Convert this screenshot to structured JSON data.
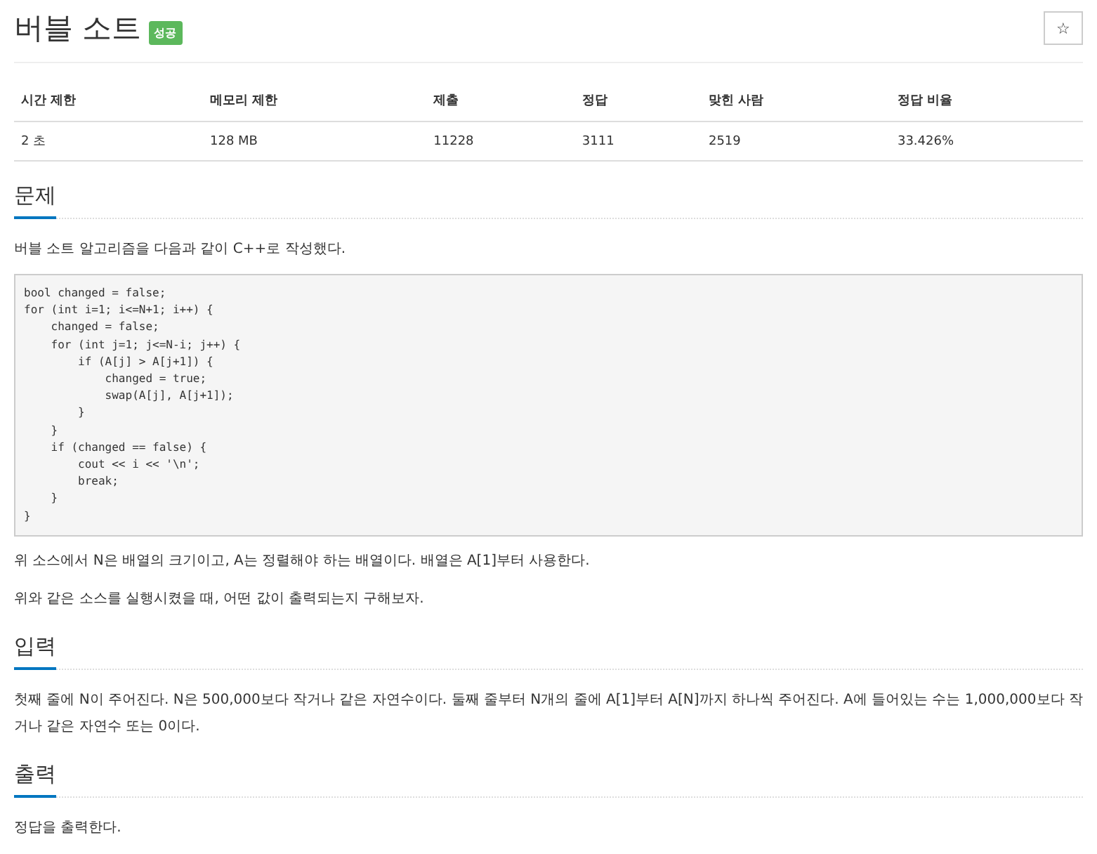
{
  "title": "버블 소트",
  "badge": "성공",
  "star_button": "☆",
  "stats": {
    "columns": [
      "시간 제한",
      "메모리 제한",
      "제출",
      "정답",
      "맞힌 사람",
      "정답 비율"
    ],
    "rows": [
      [
        "2 초",
        "128 MB",
        "11228",
        "3111",
        "2519",
        "33.426%"
      ]
    ]
  },
  "sections": [
    {
      "heading": "문제",
      "blocks": [
        {
          "kind": "text",
          "text": "버블 소트 알고리즘을 다음과 같이 C++로 작성했다."
        },
        {
          "kind": "code",
          "text": "bool changed = false;\nfor (int i=1; i<=N+1; i++) {\n    changed = false;\n    for (int j=1; j<=N-i; j++) {\n        if (A[j] > A[j+1]) {\n            changed = true;\n            swap(A[j], A[j+1]);\n        }\n    }\n    if (changed == false) {\n        cout << i << '\\n';\n        break;\n    }\n}"
        },
        {
          "kind": "text",
          "text": "위 소스에서 N은 배열의 크기이고, A는 정렬해야 하는 배열이다. 배열은 A[1]부터 사용한다."
        },
        {
          "kind": "text",
          "text": "위와 같은 소스를 실행시켰을 때, 어떤 값이 출력되는지 구해보자."
        }
      ]
    },
    {
      "heading": "입력",
      "blocks": [
        {
          "kind": "text",
          "text": "첫째 줄에 N이 주어진다. N은 500,000보다 작거나 같은 자연수이다. 둘째 줄부터 N개의 줄에 A[1]부터 A[N]까지 하나씩 주어진다. A에 들어있는 수는 1,000,000보다 작거나 같은 자연수 또는 0이다."
        }
      ]
    },
    {
      "heading": "출력",
      "blocks": [
        {
          "kind": "text",
          "text": "정답을 출력한다."
        }
      ]
    }
  ]
}
